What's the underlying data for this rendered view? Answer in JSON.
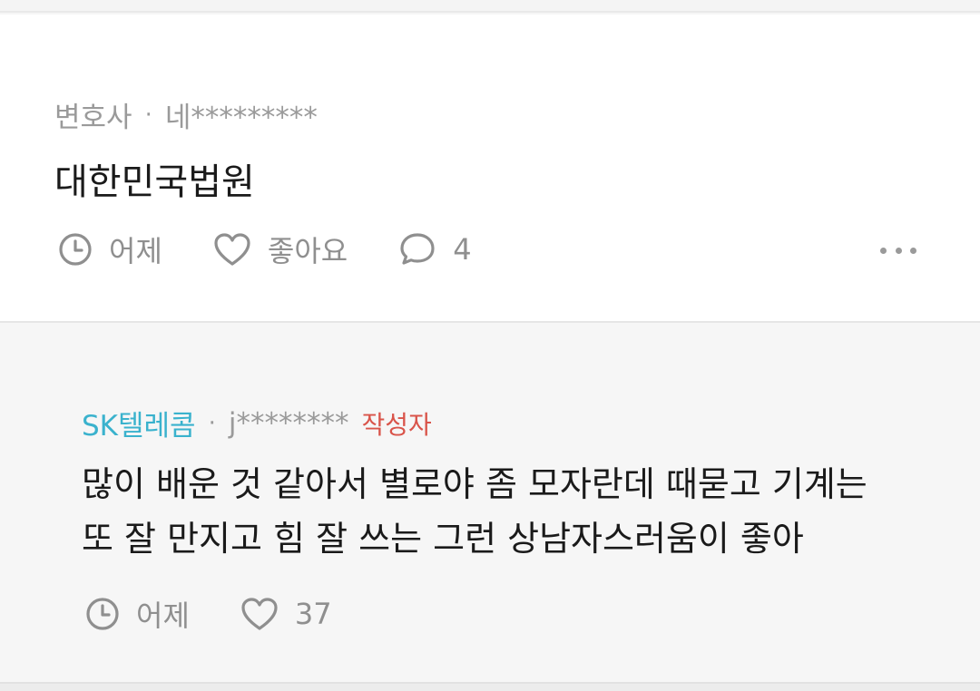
{
  "post": {
    "job": "변호사",
    "separator": "·",
    "user": "네*********",
    "body": "대한민국법원",
    "time": "어제",
    "like_label": "좋아요",
    "comment_count": "4"
  },
  "reply": {
    "company": "SK텔레콤",
    "separator": "·",
    "user": "j********",
    "author_badge": "작성자",
    "body_line1": "많이 배운 것 같아서 별로야 좀 모자란데 때묻고 기계는",
    "body_line2": "또 잘 만지고 힘 잘 쓰는 그런 상남자스러움이 좋아",
    "time": "어제",
    "like_count": "37"
  },
  "colors": {
    "company": "#3ab2cd",
    "author_badge": "#d9544a",
    "meta_gray": "#9a9a9a",
    "body_text": "#1a1a1a"
  },
  "icons": [
    "clock-icon",
    "heart-icon",
    "comment-bubble-icon",
    "more-dots-icon"
  ]
}
